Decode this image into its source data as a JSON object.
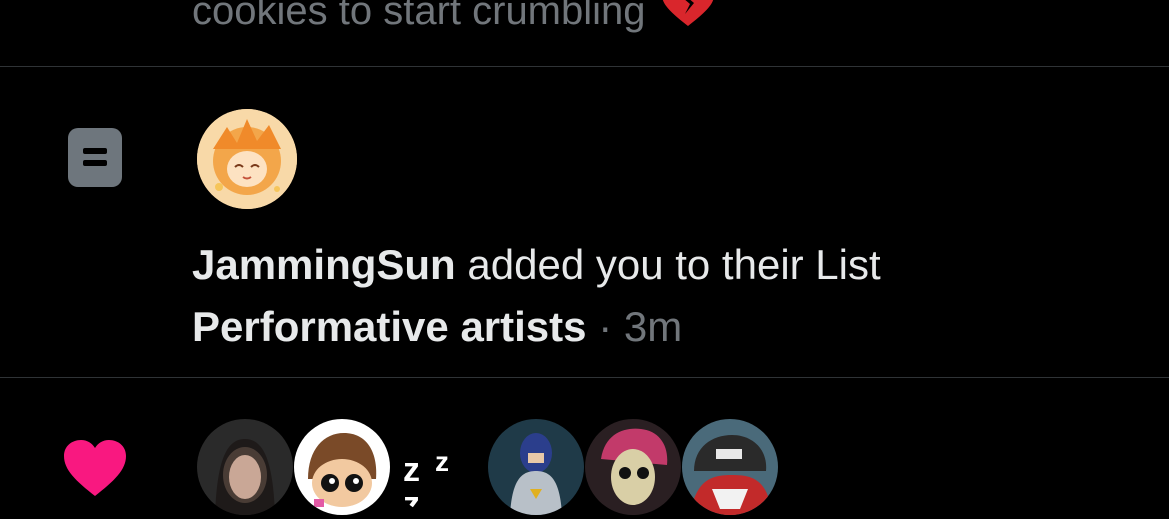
{
  "notifications": [
    {
      "type": "truncated_text",
      "text": "cookies to start crumbling",
      "emoji_icon": "broken-heart-icon"
    },
    {
      "type": "list_add",
      "icon": "list-icon",
      "user": "JammingSun",
      "action": "added you to their List",
      "list_name": "Performative artists",
      "separator": "·",
      "time": "3m"
    },
    {
      "type": "likes",
      "icon": "heart-icon",
      "avatar_count": 6
    }
  ],
  "colors": {
    "background": "#000000",
    "divider": "#2f3336",
    "text_primary": "#e7e9ea",
    "text_secondary": "#71767b",
    "like_pink": "#f91880",
    "list_icon_bg": "#6e767d"
  }
}
